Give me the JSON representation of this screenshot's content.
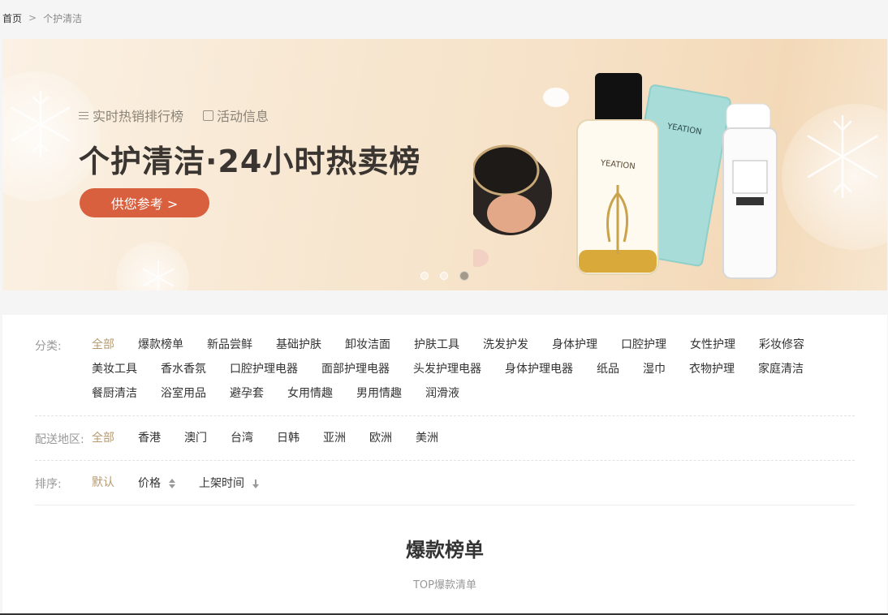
{
  "breadcrumb": {
    "home": "首页",
    "separator": ">",
    "current": "个护清洁"
  },
  "banner": {
    "tags": [
      "实时热销排行榜",
      "活动信息"
    ],
    "title": "个护清洁·24小时热卖榜",
    "cta": "供您参考 >",
    "slides": 3,
    "active_slide": 3
  },
  "filters": {
    "category": {
      "label": "分类:",
      "options": [
        "全部",
        "爆款榜单",
        "新品尝鲜",
        "基础护肤",
        "卸妆洁面",
        "护肤工具",
        "洗发护发",
        "身体护理",
        "口腔护理",
        "女性护理",
        "彩妆修容",
        "美妆工具",
        "香水香氛",
        "口腔护理电器",
        "面部护理电器",
        "头发护理电器",
        "身体护理电器",
        "纸品",
        "湿巾",
        "衣物护理",
        "家庭清洁",
        "餐厨清洁",
        "浴室用品",
        "避孕套",
        "女用情趣",
        "男用情趣",
        "润滑液"
      ],
      "selected": "全部"
    },
    "region": {
      "label": "配送地区:",
      "options": [
        "全部",
        "香港",
        "澳门",
        "台湾",
        "日韩",
        "亚洲",
        "欧洲",
        "美洲"
      ],
      "selected": "全部"
    },
    "sort": {
      "label": "排序:",
      "default": "默认",
      "price": "价格",
      "time": "上架时间"
    }
  },
  "section": {
    "title": "爆款榜单",
    "subtitle": "TOP爆款清单"
  },
  "colors": {
    "accent": "#b79a70",
    "cta": "#d8603e"
  },
  "products": {
    "bottle_label": "YEATION",
    "mask_label": "YEATION"
  }
}
